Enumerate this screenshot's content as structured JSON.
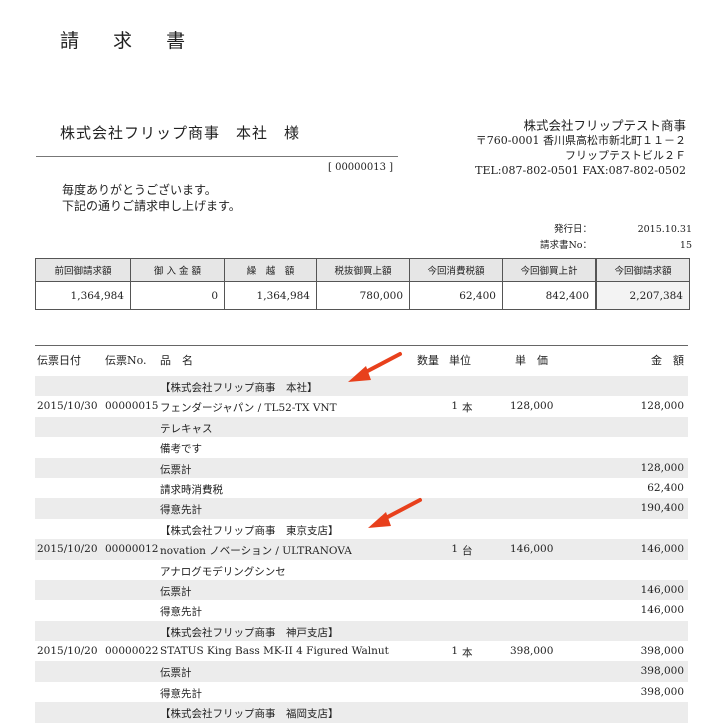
{
  "header": {
    "title": "請 求 書",
    "customer": "株式会社フリップ商事　本社　様",
    "invoice_code": "[ 00000013 ]",
    "greeting_1": "毎度ありがとうございます。",
    "greeting_2": "下記の通りご請求申し上げます。"
  },
  "issuer": {
    "company": "株式会社フリップテスト商事",
    "address_1": "〒760-0001 香川県高松市新北町１１－２",
    "address_2": "フリップテストビル２Ｆ",
    "contact": "TEL:087-802-0501 FAX:087-802-0502"
  },
  "meta": {
    "issue_date_label": "発行日：",
    "issue_date": "2015.10.31",
    "invoice_no_label": "請求書No：",
    "invoice_no": "15"
  },
  "summary": {
    "headers": [
      "前回御請求額",
      "御 入 金 額",
      "繰　越　額",
      "税抜御買上額",
      "今回消費税額",
      "今回御買上計"
    ],
    "values": [
      "1,364,984",
      "0",
      "1,364,984",
      "780,000",
      "62,400",
      "842,400"
    ],
    "total_header": "今回御請求額",
    "total_value": "2,207,384"
  },
  "detail_headers": {
    "date": "伝票日付",
    "slip_no": "伝票No.",
    "name": "品　名",
    "qty": "数量",
    "unit": "単位",
    "price": "単　価",
    "amount": "金　額"
  },
  "rows": [
    {
      "date": "",
      "no": "",
      "name": "【株式会社フリップ商事　本社】",
      "qty": "",
      "unit": "",
      "price": "",
      "amount": ""
    },
    {
      "date": "2015/10/30",
      "no": "00000015",
      "name": "フェンダージャパン / TL52-TX VNT",
      "qty": "1",
      "unit": "本",
      "price": "128,000",
      "amount": "128,000"
    },
    {
      "date": "",
      "no": "",
      "name": "テレキャス",
      "qty": "",
      "unit": "",
      "price": "",
      "amount": ""
    },
    {
      "date": "",
      "no": "",
      "name": "備考です",
      "qty": "",
      "unit": "",
      "price": "",
      "amount": ""
    },
    {
      "date": "",
      "no": "",
      "name": "伝票計",
      "qty": "",
      "unit": "",
      "price": "",
      "amount": "128,000"
    },
    {
      "date": "",
      "no": "",
      "name": "請求時消費税",
      "qty": "",
      "unit": "",
      "price": "",
      "amount": "62,400"
    },
    {
      "date": "",
      "no": "",
      "name": "得意先計",
      "qty": "",
      "unit": "",
      "price": "",
      "amount": "190,400"
    },
    {
      "date": "",
      "no": "",
      "name": "【株式会社フリップ商事　東京支店】",
      "qty": "",
      "unit": "",
      "price": "",
      "amount": ""
    },
    {
      "date": "2015/10/20",
      "no": "00000012",
      "name": "novation ノベーション / ULTRANOVA",
      "qty": "1",
      "unit": "台",
      "price": "146,000",
      "amount": "146,000"
    },
    {
      "date": "",
      "no": "",
      "name": "アナログモデリングシンセ",
      "qty": "",
      "unit": "",
      "price": "",
      "amount": ""
    },
    {
      "date": "",
      "no": "",
      "name": "伝票計",
      "qty": "",
      "unit": "",
      "price": "",
      "amount": "146,000"
    },
    {
      "date": "",
      "no": "",
      "name": "得意先計",
      "qty": "",
      "unit": "",
      "price": "",
      "amount": "146,000"
    },
    {
      "date": "",
      "no": "",
      "name": "【株式会社フリップ商事　神戸支店】",
      "qty": "",
      "unit": "",
      "price": "",
      "amount": ""
    },
    {
      "date": "2015/10/20",
      "no": "00000022",
      "name": "STATUS King Bass MK-II 4 Figured Walnut",
      "qty": "1",
      "unit": "本",
      "price": "398,000",
      "amount": "398,000"
    },
    {
      "date": "",
      "no": "",
      "name": "伝票計",
      "qty": "",
      "unit": "",
      "price": "",
      "amount": "398,000"
    },
    {
      "date": "",
      "no": "",
      "name": "得意先計",
      "qty": "",
      "unit": "",
      "price": "",
      "amount": "398,000"
    },
    {
      "date": "",
      "no": "",
      "name": "【株式会社フリップ商事　福岡支店】",
      "qty": "",
      "unit": "",
      "price": "",
      "amount": ""
    }
  ],
  "colors": {
    "shade": "#ececec",
    "header_fill": "#e6e6e6",
    "arrow": "#e8401c"
  }
}
